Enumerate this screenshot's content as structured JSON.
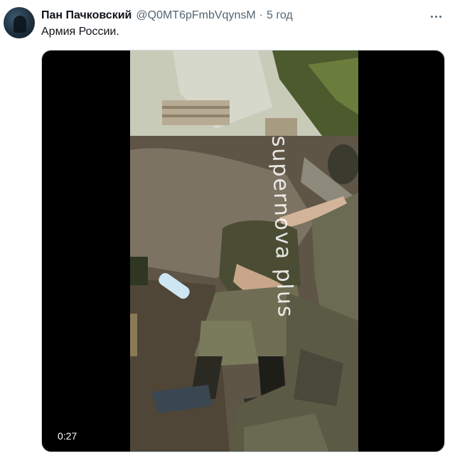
{
  "tweet": {
    "author_name": "Пан Пачковский",
    "author_handle": "@Q0MT6pFmbVqynsM",
    "separator": "·",
    "timestamp": "5 год",
    "text": "Армия России.",
    "more_icon": "more-horizontal-icon"
  },
  "media": {
    "video_duration": "0:27",
    "watermark": "supernova plus"
  }
}
